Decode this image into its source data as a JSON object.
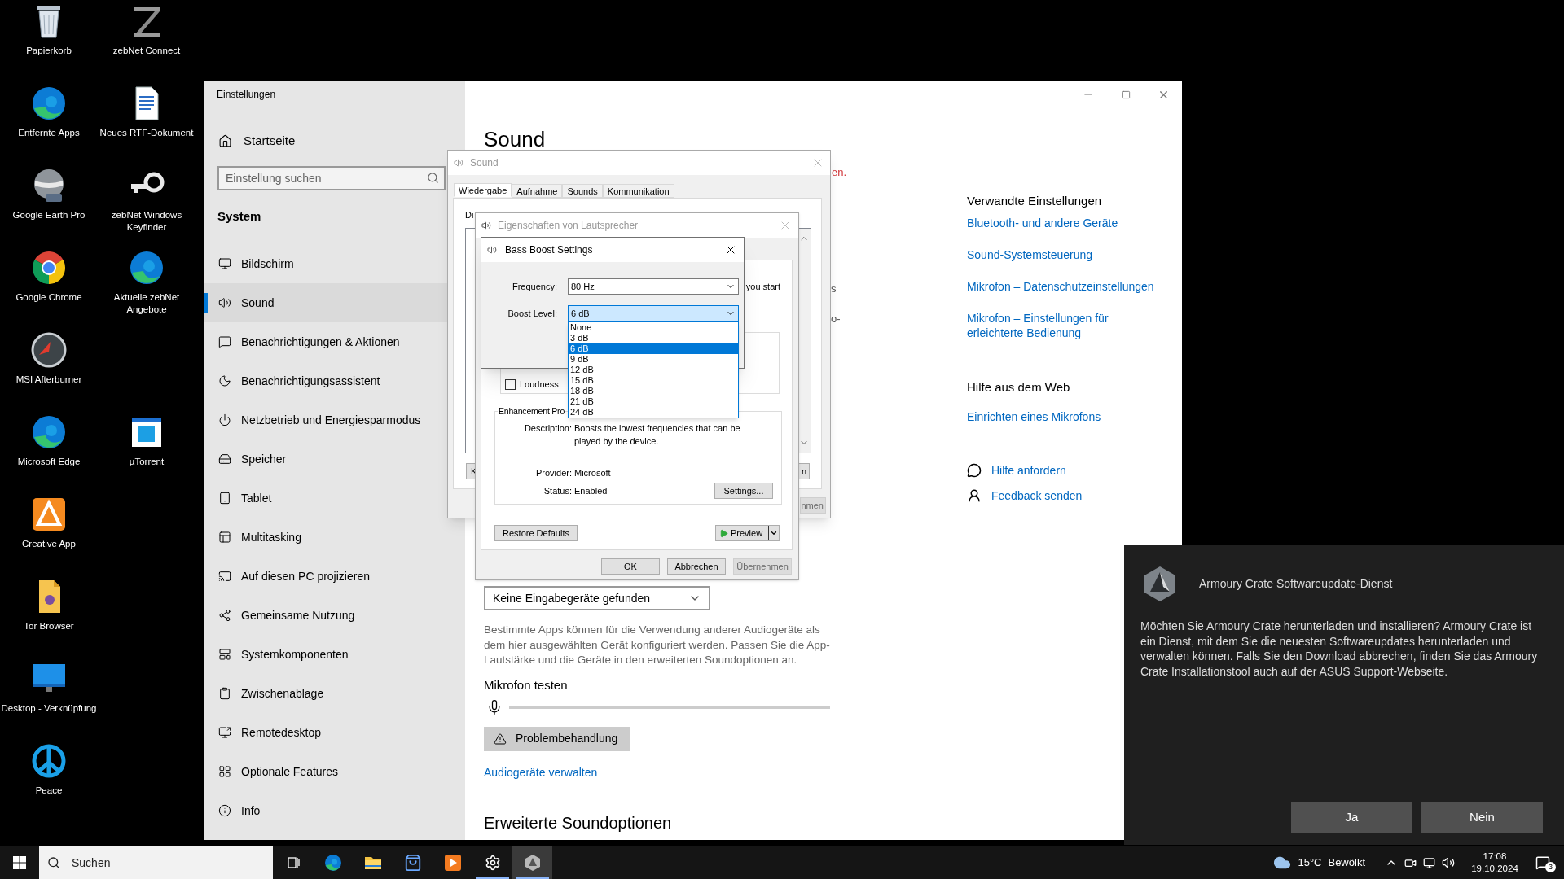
{
  "desktop": {
    "rows": [
      [
        {
          "label": "Papierkorb",
          "kind": "trash"
        },
        {
          "label": "zebNet Connect",
          "kind": "zebnet"
        }
      ],
      [
        {
          "label": "Entfernte Apps",
          "kind": "edge"
        },
        {
          "label": "Neues RTF-Dokument",
          "kind": "document"
        }
      ],
      [
        {
          "label": "Google Earth Pro",
          "kind": "earth"
        },
        {
          "label": "zebNet Windows Keyfinder",
          "kind": "key"
        }
      ],
      [
        {
          "label": "Google Chrome",
          "kind": "chrome"
        },
        {
          "label": "Aktuelle zebNet Angebote",
          "kind": "edge"
        }
      ],
      [
        {
          "label": "MSI Afterburner",
          "kind": "afterburner"
        }
      ],
      [
        {
          "label": "Microsoft Edge",
          "kind": "edge"
        },
        {
          "label": "µTorrent",
          "kind": "torrent"
        }
      ],
      [
        {
          "label": "Creative App",
          "kind": "creative"
        }
      ],
      [
        {
          "label": "Tor Browser",
          "kind": "folder"
        }
      ],
      [
        {
          "label": "Desktop - Verknüpfung",
          "kind": "monitor"
        }
      ],
      [
        {
          "label": "Peace",
          "kind": "peace"
        }
      ]
    ]
  },
  "settings": {
    "title": "Einstellungen",
    "home": "Startseite",
    "search": {
      "placeholder": "Einstellung suchen"
    },
    "section": "System",
    "nav": [
      {
        "label": "Bildschirm",
        "kind": "monitor",
        "selected": false
      },
      {
        "label": "Sound",
        "kind": "sound",
        "selected": true
      },
      {
        "label": "Benachrichtigungen & Aktionen",
        "kind": "notify",
        "selected": false
      },
      {
        "label": "Benachrichtigungsassistent",
        "kind": "moon",
        "selected": false
      },
      {
        "label": "Netzbetrieb und Energiesparmodus",
        "kind": "power",
        "selected": false
      },
      {
        "label": "Speicher",
        "kind": "storage",
        "selected": false
      },
      {
        "label": "Tablet",
        "kind": "tablet",
        "selected": false
      },
      {
        "label": "Multitasking",
        "kind": "multitask",
        "selected": false
      },
      {
        "label": "Auf diesen PC projizieren",
        "kind": "project",
        "selected": false
      },
      {
        "label": "Gemeinsame Nutzung",
        "kind": "share",
        "selected": false
      },
      {
        "label": "Systemkomponenten",
        "kind": "components",
        "selected": false
      },
      {
        "label": "Zwischenablage",
        "kind": "clipboard",
        "selected": false
      },
      {
        "label": "Remotedesktop",
        "kind": "remote",
        "selected": false
      },
      {
        "label": "Optionale Features",
        "kind": "features",
        "selected": false
      },
      {
        "label": "Info",
        "kind": "info",
        "selected": false
      }
    ],
    "page_title": "Sound",
    "warning_fragment": "en.",
    "fragments": [
      "s",
      "o-"
    ],
    "input_device": "Keine Eingabegeräte gefunden",
    "description": "Bestimmte Apps können für die Verwendung anderer Audiogeräte als dem hier ausgewählten Gerät konfiguriert werden. Passen Sie die App-Lautstärke und die Geräte in den erweiterten Soundoptionen an.",
    "mic_test": {
      "label": "Mikrofon testen",
      "level": 0
    },
    "troubleshoot": "Problembehandlung",
    "manage_link": "Audiogeräte verwalten",
    "advanced_heading": "Erweiterte Soundoptionen",
    "related": {
      "heading": "Verwandte Einstellungen",
      "links": [
        "Bluetooth- und andere Geräte",
        "Sound-Systemsteuerung",
        "Mikrofon – Datenschutzeinstellungen",
        "Mikrofon – Einstellungen für erleichterte Bedienung"
      ]
    },
    "web_help": {
      "heading": "Hilfe aus dem Web",
      "links": [
        "Einrichten eines Mikrofons"
      ]
    },
    "support": [
      {
        "label": "Hilfe anfordern",
        "kind": "help"
      },
      {
        "label": "Feedback senden",
        "kind": "feedback"
      }
    ]
  },
  "sound_dialog": {
    "title": "Sound",
    "tabs": [
      {
        "label": "Wiedergabe",
        "selected": true
      },
      {
        "label": "Aufnahme",
        "selected": false
      },
      {
        "label": "Sounds",
        "selected": false
      },
      {
        "label": "Kommunikation",
        "selected": false
      }
    ],
    "intro_fragment": "Di",
    "left_button_fragment": "K",
    "right_button_fragment": "n",
    "apply_fragment": {
      "label": "nmen",
      "disabled": true
    }
  },
  "properties_dialog": {
    "title": "Eigenschaften von Lautsprecher",
    "hint_fragment": "you start",
    "checkboxes": [
      {
        "label": "Loudness",
        "checked": false
      }
    ],
    "group_label": "Enhancement Pro",
    "description_label": "Description:",
    "description": "Boosts the lowest frequencies that can be played by the device.",
    "provider_label": "Provider:",
    "provider": "Microsoft",
    "status_label": "Status:",
    "status": "Enabled",
    "settings_button": "Settings...",
    "restore_button": "Restore Defaults",
    "preview_button": "Preview",
    "buttons": [
      {
        "label": "OK",
        "disabled": false
      },
      {
        "label": "Abbrechen",
        "disabled": false
      },
      {
        "label": "Übernehmen",
        "disabled": true
      }
    ]
  },
  "bass_boost": {
    "title": "Bass Boost Settings",
    "frequency": {
      "label": "Frequency:",
      "value": "80 Hz"
    },
    "boost": {
      "label": "Boost Level:",
      "value": "6 dB",
      "expanded": true,
      "options": [
        {
          "label": "None",
          "selected": false
        },
        {
          "label": "3 dB",
          "selected": false
        },
        {
          "label": "6 dB",
          "selected": true
        },
        {
          "label": "9 dB",
          "selected": false
        },
        {
          "label": "12 dB",
          "selected": false
        },
        {
          "label": "15 dB",
          "selected": false
        },
        {
          "label": "18 dB",
          "selected": false
        },
        {
          "label": "21 dB",
          "selected": false
        },
        {
          "label": "24 dB",
          "selected": false
        }
      ]
    }
  },
  "notification": {
    "title": "Armoury Crate Softwareupdate-Dienst",
    "body": "Möchten Sie Armoury Crate herunterladen und installieren? Armoury Crate ist ein Dienst, mit dem Sie die neuesten Softwareupdates herunterladen und verwalten können. Falls Sie den Download abbrechen, finden Sie das Armoury Crate Installationstool auch auf der ASUS Support-Webseite.",
    "buttons": [
      "Ja",
      "Nein"
    ]
  },
  "taskbar": {
    "search_placeholder": "Suchen",
    "apps": [
      {
        "kind": "taskview",
        "running": false,
        "active": false
      },
      {
        "kind": "edge",
        "running": false,
        "active": false
      },
      {
        "kind": "explorer",
        "running": false,
        "active": false
      },
      {
        "kind": "store",
        "running": false,
        "active": false
      },
      {
        "kind": "media",
        "running": false,
        "active": false
      },
      {
        "kind": "settings",
        "running": true,
        "active": false
      },
      {
        "kind": "armoury",
        "running": true,
        "active": true
      }
    ],
    "temperature": "15°C",
    "weather": "Bewölkt",
    "time": "17:08",
    "date": "19.10.2024",
    "notification_count": "3"
  }
}
